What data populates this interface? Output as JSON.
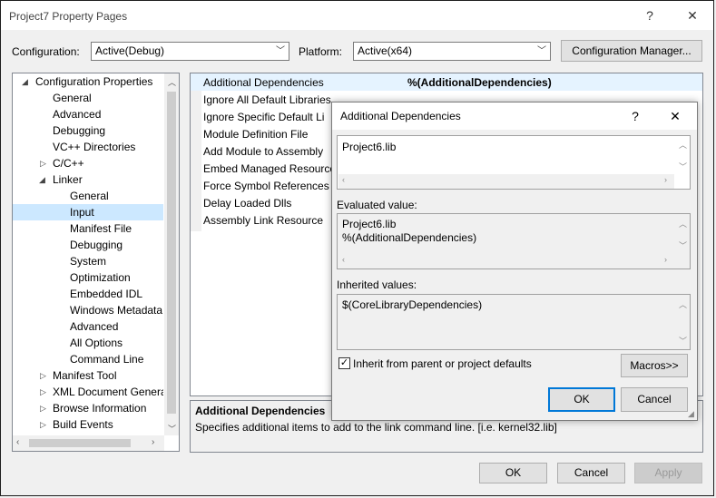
{
  "window": {
    "title": "Project7 Property Pages",
    "help_glyph": "?",
    "close_glyph": "✕"
  },
  "config_bar": {
    "configuration_label": "Configuration:",
    "configuration_value": "Active(Debug)",
    "platform_label": "Platform:",
    "platform_value": "Active(x64)",
    "config_manager_label": "Configuration Manager..."
  },
  "tree": {
    "root": "Configuration Properties",
    "items": [
      "General",
      "Advanced",
      "Debugging",
      "VC++ Directories",
      "C/C++",
      "Linker",
      "General",
      "Input",
      "Manifest File",
      "Debugging",
      "System",
      "Optimization",
      "Embedded IDL",
      "Windows Metadata",
      "Advanced",
      "All Options",
      "Command Line",
      "Manifest Tool",
      "XML Document Genera",
      "Browse Information",
      "Build Events"
    ]
  },
  "properties": {
    "rows": [
      "Additional Dependencies",
      "Ignore All Default Libraries",
      "Ignore Specific Default Li",
      "Module Definition File",
      "Add Module to Assembly",
      "Embed Managed Resource",
      "Force Symbol References",
      "Delay Loaded Dlls",
      "Assembly Link Resource"
    ],
    "selected_value": "%(AdditionalDependencies)"
  },
  "description": {
    "title": "Additional Dependencies",
    "text": "Specifies additional items to add to the link command line. [i.e. kernel32.lib]"
  },
  "footer": {
    "ok": "OK",
    "cancel": "Cancel",
    "apply": "Apply"
  },
  "dialog": {
    "title": "Additional Dependencies",
    "help_glyph": "?",
    "close_glyph": "✕",
    "edit_value": "Project6.lib",
    "evaluated_label": "Evaluated value:",
    "evaluated_lines": [
      "Project6.lib",
      "%(AdditionalDependencies)"
    ],
    "inherited_label": "Inherited values:",
    "inherited_value": "$(CoreLibraryDependencies)",
    "inherit_checkbox_label": "Inherit from parent or project defaults",
    "macros_label": "Macros>>",
    "ok": "OK",
    "cancel": "Cancel"
  },
  "colors": {
    "selection": "#cce8ff",
    "accent": "#0078d7"
  }
}
